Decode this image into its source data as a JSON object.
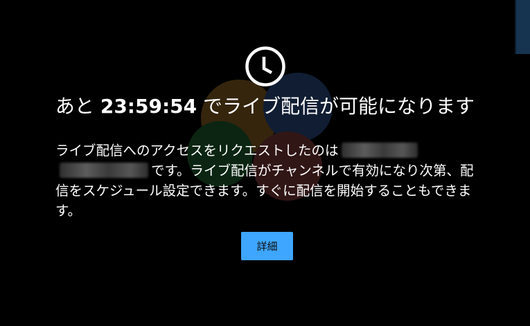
{
  "dialog": {
    "title_prefix": "あと",
    "countdown": "23:59:54",
    "title_suffix": "でライブ配信が可能になります",
    "description_part1": "ライブ配信へのアクセスをリクエストしたのは",
    "description_part2": "です。ライブ配信がチャンネルで有効になり次第、配信をスケジュール設定できます。すぐに配信を開始することもできます。",
    "learn_more_label": "詳細",
    "icon": "clock-icon",
    "button_color": "#3ea6ff"
  }
}
